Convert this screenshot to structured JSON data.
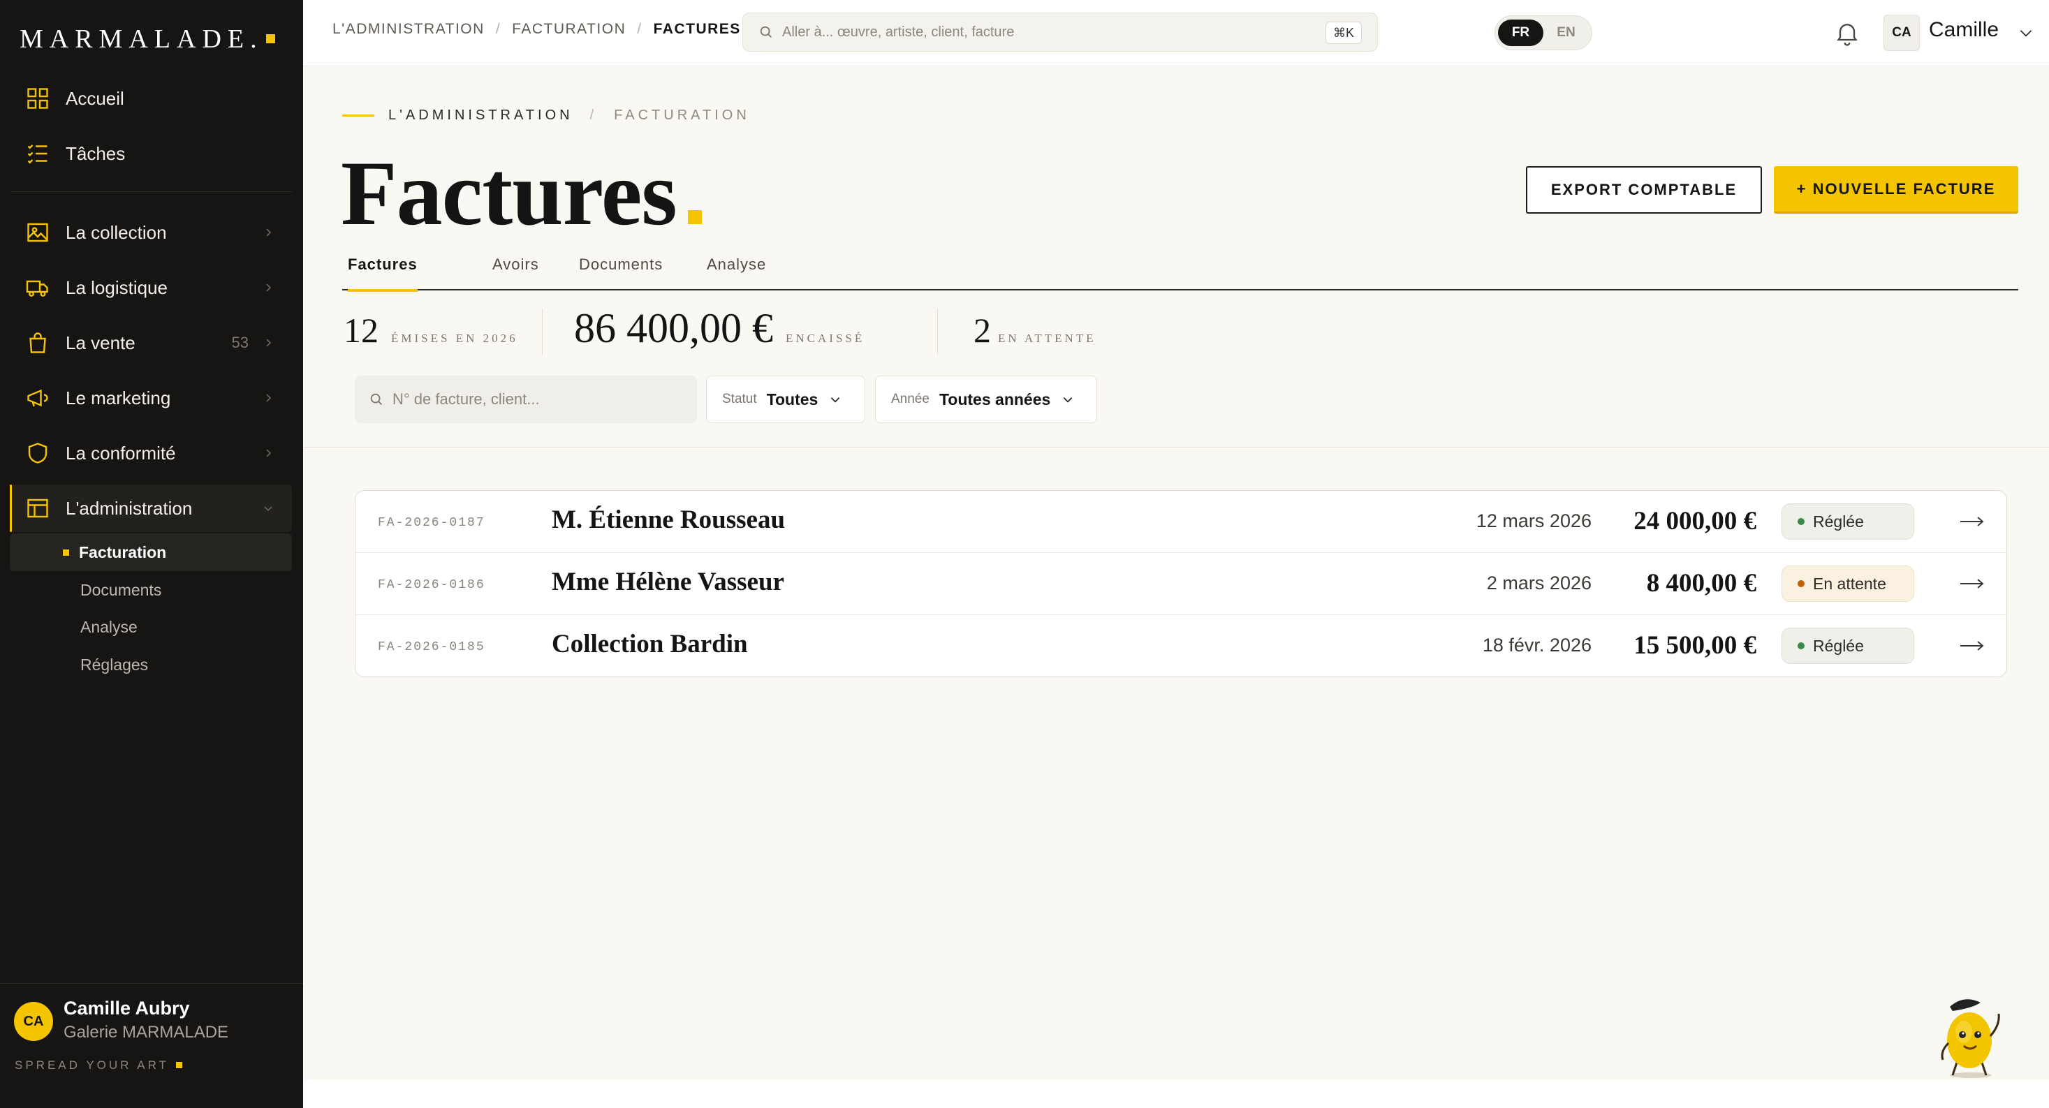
{
  "sidebar": {
    "logo": "MARMALADE.",
    "items": [
      {
        "label": "Accueil",
        "icon": "grid-icon"
      },
      {
        "label": "Tâches",
        "icon": "checklist-icon"
      },
      {
        "label": "La collection",
        "icon": "image-icon"
      },
      {
        "label": "La logistique",
        "icon": "truck-icon"
      },
      {
        "label": "La vente",
        "icon": "bag-icon",
        "count": "53"
      },
      {
        "label": "Le marketing",
        "icon": "megaphone-icon"
      },
      {
        "label": "La conformité",
        "icon": "shield-icon"
      },
      {
        "label": "L'administration",
        "icon": "window-icon"
      }
    ],
    "subitems": [
      "Facturation",
      "Documents",
      "Analyse",
      "Réglages"
    ],
    "user": {
      "initials": "CA",
      "name": "Camille Aubry",
      "org": "Galerie MARMALADE",
      "tagline": "SPREAD YOUR ART"
    }
  },
  "topbar": {
    "breadcrumbs": [
      "L'ADMINISTRATION",
      "FACTURATION",
      "FACTURES"
    ],
    "search_placeholder": "Aller à... œuvre, artiste, client, facture",
    "shortcut": "⌘K",
    "langs": [
      "FR",
      "EN"
    ],
    "active_lang": "FR",
    "user_initials": "CA",
    "user_name": "Camille"
  },
  "page": {
    "eyebrow": [
      "L'ADMINISTRATION",
      "FACTURATION"
    ],
    "title": "Factures",
    "export_label": "EXPORT COMPTABLE",
    "new_label": "+ NOUVELLE FACTURE",
    "tabs": [
      "Factures",
      "Avoirs",
      "Documents",
      "Analyse"
    ],
    "active_tab": "Factures",
    "stats": [
      {
        "value": "12",
        "caption": "ÉMISES EN 2026"
      },
      {
        "value": "86 400,00 €",
        "caption": "ENCAISSÉ"
      },
      {
        "value": "2",
        "caption": "EN ATTENTE"
      }
    ],
    "filters": {
      "search_placeholder": "N° de facture, client...",
      "status_label": "Statut",
      "status_value": "Toutes",
      "year_label": "Année",
      "year_value": "Toutes années"
    },
    "invoices": [
      {
        "ref": "FA-2026-0187",
        "client": "M. Étienne Rousseau",
        "date": "12 mars 2026",
        "amount": "24 000,00 €",
        "status": "Réglée",
        "status_kind": "paid"
      },
      {
        "ref": "FA-2026-0186",
        "client": "Mme Hélène Vasseur",
        "date": "2 mars 2026",
        "amount": "8 400,00 €",
        "status": "En attente",
        "status_kind": "wait"
      },
      {
        "ref": "FA-2026-0185",
        "client": "Collection Bardin",
        "date": "18 févr. 2026",
        "amount": "15 500,00 €",
        "status": "Réglée",
        "status_kind": "paid"
      }
    ]
  },
  "colors": {
    "accent": "#f5c400",
    "sidebar_bg": "#161513",
    "paid": "#3a8a4b",
    "pending": "#c4620a"
  }
}
